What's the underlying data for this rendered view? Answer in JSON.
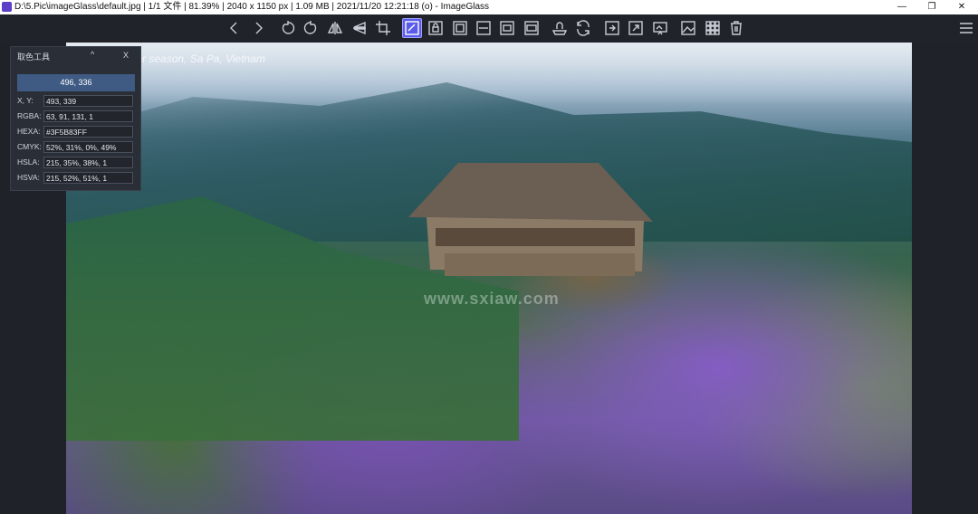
{
  "window": {
    "title": "D:\\5.Pic\\imageGlass\\default.jpg  |  1/1 文件  |  81.39%  |  2040 x 1150 px  |  1.09 MB  |  2021/11/20 12:21:18 (o)  - ImageGlass",
    "minimize": "—",
    "maximize": "❐",
    "close": "✕"
  },
  "toolbar": {
    "menu_icon": "hamburger-menu-icon",
    "active_button": "color-picker"
  },
  "photo": {
    "caption": "Purple flower season, Sa Pa, Vietnam",
    "watermark": "www.sxiaw.com"
  },
  "color_picker": {
    "title": "取色工具",
    "minimize": "^",
    "close": "X",
    "swatch_color": "#3F5B83",
    "swatch_text": "496, 336",
    "rows": [
      {
        "label": "X, Y:",
        "value": "493, 339"
      },
      {
        "label": "RGBA:",
        "value": "63, 91, 131, 1"
      },
      {
        "label": "HEXA:",
        "value": "#3F5B83FF"
      },
      {
        "label": "CMYK:",
        "value": "52%, 31%, 0%, 49%"
      },
      {
        "label": "HSLA:",
        "value": "215, 35%, 38%, 1"
      },
      {
        "label": "HSVA:",
        "value": "215, 52%, 51%, 1"
      }
    ]
  }
}
